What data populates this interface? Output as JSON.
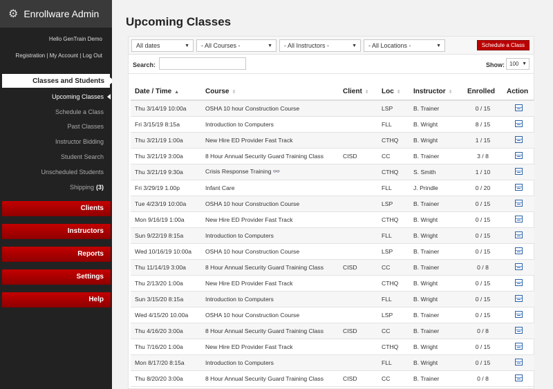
{
  "app": {
    "title": "Enrollware Admin",
    "hello": "Hello GenTrain Demo"
  },
  "toplinks": [
    "Registration",
    "My Account",
    "Log Out"
  ],
  "nav": {
    "section": "Classes and Students",
    "items": [
      {
        "label": "Upcoming Classes",
        "active": true
      },
      {
        "label": "Schedule a Class"
      },
      {
        "label": "Past Classes"
      },
      {
        "label": "Instructor Bidding"
      },
      {
        "label": "Student Search"
      },
      {
        "label": "Unscheduled Students"
      },
      {
        "label": "Shipping",
        "badge": "(3)"
      }
    ],
    "groups": [
      "Clients",
      "Instructors",
      "Reports",
      "Settings",
      "Help"
    ]
  },
  "page": {
    "title": "Upcoming Classes"
  },
  "filters": {
    "dates": "All dates",
    "courses": "- All Courses -",
    "instructors": "- All Instructors -",
    "locations": "- All Locations -",
    "schedule_button": "Schedule a Class"
  },
  "search": {
    "label": "Search:",
    "value": "",
    "show_label": "Show:",
    "show_value": "100"
  },
  "table": {
    "headers": [
      "Date / Time",
      "Course",
      "Client",
      "Loc",
      "Instructor",
      "Enrolled",
      "Action"
    ],
    "rows": [
      [
        "Thu 3/14/19 10:00a",
        "OSHA 10 hour Construction Course",
        "",
        "LSP",
        "B. Trainer",
        "0 / 15"
      ],
      [
        "Fri 3/15/19 8:15a",
        "Introduction to Computers",
        "",
        "FLL",
        "B. Wright",
        "8 / 15"
      ],
      [
        "Thu 3/21/19 1:00a",
        "New Hire ED Provider Fast Track",
        "",
        "CTHQ",
        "B. Wright",
        "1 / 15"
      ],
      [
        "Thu 3/21/19 3:00a",
        "8 Hour Annual Security Guard Training Class",
        "CISD",
        "CC",
        "B. Trainer",
        "3 / 8"
      ],
      [
        "Thu 3/21/19 9:30a",
        "Crisis Response Training 👓",
        "",
        "CTHQ",
        "S. Smith",
        "1 / 10"
      ],
      [
        "Fri 3/29/19 1.00p",
        "Infant Care",
        "",
        "FLL",
        "J. Prindle",
        "0 / 20"
      ],
      [
        "Tue 4/23/19 10:00a",
        "OSHA 10 hour Construction Course",
        "",
        "LSP",
        "B. Trainer",
        "0 / 15"
      ],
      [
        "Mon 9/16/19 1:00a",
        "New Hire ED Provider Fast Track",
        "",
        "CTHQ",
        "B. Wright",
        "0 / 15"
      ],
      [
        "Sun 9/22/19 8:15a",
        "Introduction to Computers",
        "",
        "FLL",
        "B. Wright",
        "0 / 15"
      ],
      [
        "Wed 10/16/19 10:00a",
        "OSHA 10 hour Construction Course",
        "",
        "LSP",
        "B. Trainer",
        "0 / 15"
      ],
      [
        "Thu 11/14/19 3:00a",
        "8 Hour Annual Security Guard Training Class",
        "CISD",
        "CC",
        "B. Trainer",
        "0 / 8"
      ],
      [
        "Thu 2/13/20 1:00a",
        "New Hire ED Provider Fast Track",
        "",
        "CTHQ",
        "B. Wright",
        "0 / 15"
      ],
      [
        "Sun 3/15/20 8:15a",
        "Introduction to Computers",
        "",
        "FLL",
        "B. Wright",
        "0 / 15"
      ],
      [
        "Wed 4/15/20 10.00a",
        "OSHA 10 hour Construction Course",
        "",
        "LSP",
        "B. Trainer",
        "0 / 15"
      ],
      [
        "Thu 4/16/20 3:00a",
        "8 Hour Annual Security Guard Training Class",
        "CISD",
        "CC",
        "B. Trainer",
        "0 / 8"
      ],
      [
        "Thu 7/16/20 1:00a",
        "New Hire ED Provider Fast Track",
        "",
        "CTHQ",
        "B. Wright",
        "0 / 15"
      ],
      [
        "Mon 8/17/20 8:15a",
        "Introduction to Computers",
        "",
        "FLL",
        "B. Wright",
        "0 / 15"
      ],
      [
        "Thu 8/20/20 3:00a",
        "8 Hour Annual Security Guard Training Class",
        "CISD",
        "CC",
        "B. Trainer",
        "0 / 8"
      ]
    ]
  },
  "icons": {
    "brand": "gear-icon",
    "action": "edit-icon",
    "sort": "sort-icon"
  },
  "colors": {
    "accent_red": "#b00000",
    "sidebar_bg": "#222222"
  }
}
